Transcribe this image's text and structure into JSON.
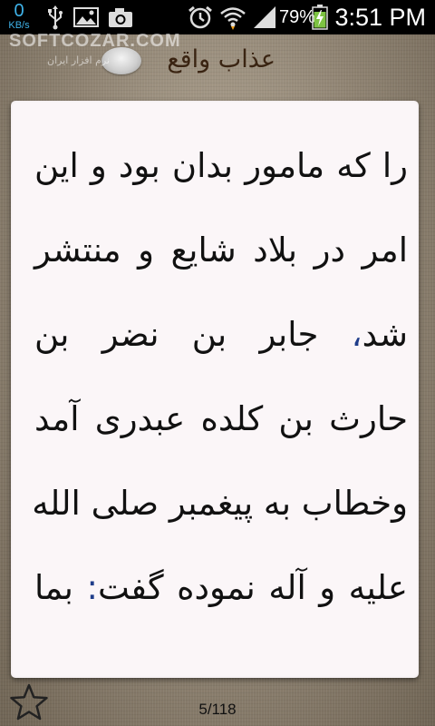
{
  "status_bar": {
    "net_speed_value": "0",
    "net_speed_unit": "KB/s",
    "battery_percent": "79%",
    "time": "3:51 PM",
    "icons": [
      "usb-icon",
      "picture-icon",
      "camera-icon",
      "alarm-icon",
      "wifi-icon",
      "signal-icon",
      "battery-charging-icon"
    ]
  },
  "watermark": {
    "brand": "SOFTCOZAR.COM",
    "tagline": "نرم افزار ایران"
  },
  "header": {
    "title": "عذاب واقع",
    "logo_icon": "app-logo-icon"
  },
  "content": {
    "lines": [
      {
        "text": "را که مامور بدان بود و این"
      },
      {
        "text": "امر در بلاد شایع و منتشر"
      },
      {
        "before": "شد",
        "punct": "،",
        "after": " جابر بن نضر بن"
      },
      {
        "text": "حارث بن کلده عبدری آمد"
      },
      {
        "text": "وخطاب به پیغمبر صلی الله"
      },
      {
        "before": "علیه و آله نموده گفت",
        "punct": ":",
        "after": " بما"
      }
    ],
    "punct_color": "#1f3d8a"
  },
  "footer": {
    "page_counter": "5/118",
    "favorite_icon": "star-outline-icon"
  }
}
